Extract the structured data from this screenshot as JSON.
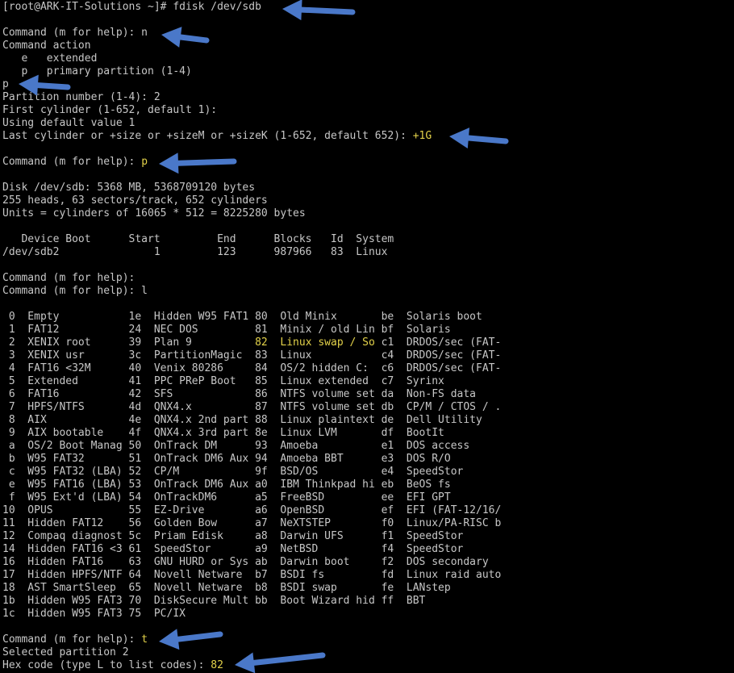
{
  "terminal": {
    "lines": [
      {
        "text": "[root@ARK-IT-Solutions ~]# fdisk /dev/sdb"
      },
      {
        "text": ""
      },
      {
        "text": "Command (m for help): n"
      },
      {
        "text": "Command action"
      },
      {
        "text": "   e   extended"
      },
      {
        "text": "   p   primary partition (1-4)"
      },
      {
        "text": "p"
      },
      {
        "text": "Partition number (1-4): 2"
      },
      {
        "text": "First cylinder (1-652, default 1):"
      },
      {
        "text": "Using default value 1"
      },
      {
        "text": "Last cylinder or +size or +sizeM or +sizeK (1-652, default 652): ",
        "hl": "+1G"
      },
      {
        "text": ""
      },
      {
        "text": "Command (m for help): ",
        "hl": "p"
      },
      {
        "text": ""
      },
      {
        "text": "Disk /dev/sdb: 5368 MB, 5368709120 bytes"
      },
      {
        "text": "255 heads, 63 sectors/track, 652 cylinders"
      },
      {
        "text": "Units = cylinders of 16065 * 512 = 8225280 bytes"
      },
      {
        "text": ""
      },
      {
        "text": "   Device Boot      Start         End      Blocks   Id  System"
      },
      {
        "text": "/dev/sdb2               1         123      987966   83  Linux"
      },
      {
        "text": ""
      },
      {
        "text": "Command (m for help):"
      },
      {
        "text": "Command (m for help): l"
      },
      {
        "text": ""
      },
      {
        "text": " 0  Empty           1e  Hidden W95 FAT1 80  Old Minix       be  Solaris boot"
      },
      {
        "text": " 1  FAT12           24  NEC DOS         81  Minix / old Lin bf  Solaris"
      },
      {
        "text": " 2  XENIX root      39  Plan 9          ",
        "hl": "82  Linux swap / So",
        "after": " c1  DRDOS/sec (FAT-"
      },
      {
        "text": " 3  XENIX usr       3c  PartitionMagic  83  Linux           c4  DRDOS/sec (FAT-"
      },
      {
        "text": " 4  FAT16 <32M      40  Venix 80286     84  OS/2 hidden C:  c6  DRDOS/sec (FAT-"
      },
      {
        "text": " 5  Extended        41  PPC PReP Boot   85  Linux extended  c7  Syrinx"
      },
      {
        "text": " 6  FAT16           42  SFS             86  NTFS volume set da  Non-FS data"
      },
      {
        "text": " 7  HPFS/NTFS       4d  QNX4.x          87  NTFS volume set db  CP/M / CTOS / ."
      },
      {
        "text": " 8  AIX             4e  QNX4.x 2nd part 88  Linux plaintext de  Dell Utility"
      },
      {
        "text": " 9  AIX bootable    4f  QNX4.x 3rd part 8e  Linux LVM       df  BootIt"
      },
      {
        "text": " a  OS/2 Boot Manag 50  OnTrack DM      93  Amoeba          e1  DOS access"
      },
      {
        "text": " b  W95 FAT32       51  OnTrack DM6 Aux 94  Amoeba BBT      e3  DOS R/O"
      },
      {
        "text": " c  W95 FAT32 (LBA) 52  CP/M            9f  BSD/OS          e4  SpeedStor"
      },
      {
        "text": " e  W95 FAT16 (LBA) 53  OnTrack DM6 Aux a0  IBM Thinkpad hi eb  BeOS fs"
      },
      {
        "text": " f  W95 Ext'd (LBA) 54  OnTrackDM6      a5  FreeBSD         ee  EFI GPT"
      },
      {
        "text": "10  OPUS            55  EZ-Drive        a6  OpenBSD         ef  EFI (FAT-12/16/"
      },
      {
        "text": "11  Hidden FAT12    56  Golden Bow      a7  NeXTSTEP        f0  Linux/PA-RISC b"
      },
      {
        "text": "12  Compaq diagnost 5c  Priam Edisk     a8  Darwin UFS      f1  SpeedStor"
      },
      {
        "text": "14  Hidden FAT16 <3 61  SpeedStor       a9  NetBSD          f4  SpeedStor"
      },
      {
        "text": "16  Hidden FAT16    63  GNU HURD or Sys ab  Darwin boot     f2  DOS secondary"
      },
      {
        "text": "17  Hidden HPFS/NTF 64  Novell Netware  b7  BSDI fs         fd  Linux raid auto"
      },
      {
        "text": "18  AST SmartSleep  65  Novell Netware  b8  BSDI swap       fe  LANstep"
      },
      {
        "text": "1b  Hidden W95 FAT3 70  DiskSecure Mult bb  Boot Wizard hid ff  BBT"
      },
      {
        "text": "1c  Hidden W95 FAT3 75  PC/IX"
      },
      {
        "text": ""
      },
      {
        "text": "Command (m for help): ",
        "hl": "t"
      },
      {
        "text": "Selected partition 2"
      },
      {
        "text": "Hex code (type L to list codes): ",
        "hl": "82"
      }
    ]
  },
  "colors": {
    "background": "#000000",
    "text": "#c7c7c7",
    "highlight": "#e3d24a",
    "arrow": "#4a78c9"
  },
  "arrows": [
    {
      "name": "arrow-fdisk-command"
    },
    {
      "name": "arrow-new-partition"
    },
    {
      "name": "arrow-primary-choice"
    },
    {
      "name": "arrow-size-input"
    },
    {
      "name": "arrow-print-command"
    },
    {
      "name": "arrow-type-command"
    },
    {
      "name": "arrow-hex-code"
    }
  ]
}
